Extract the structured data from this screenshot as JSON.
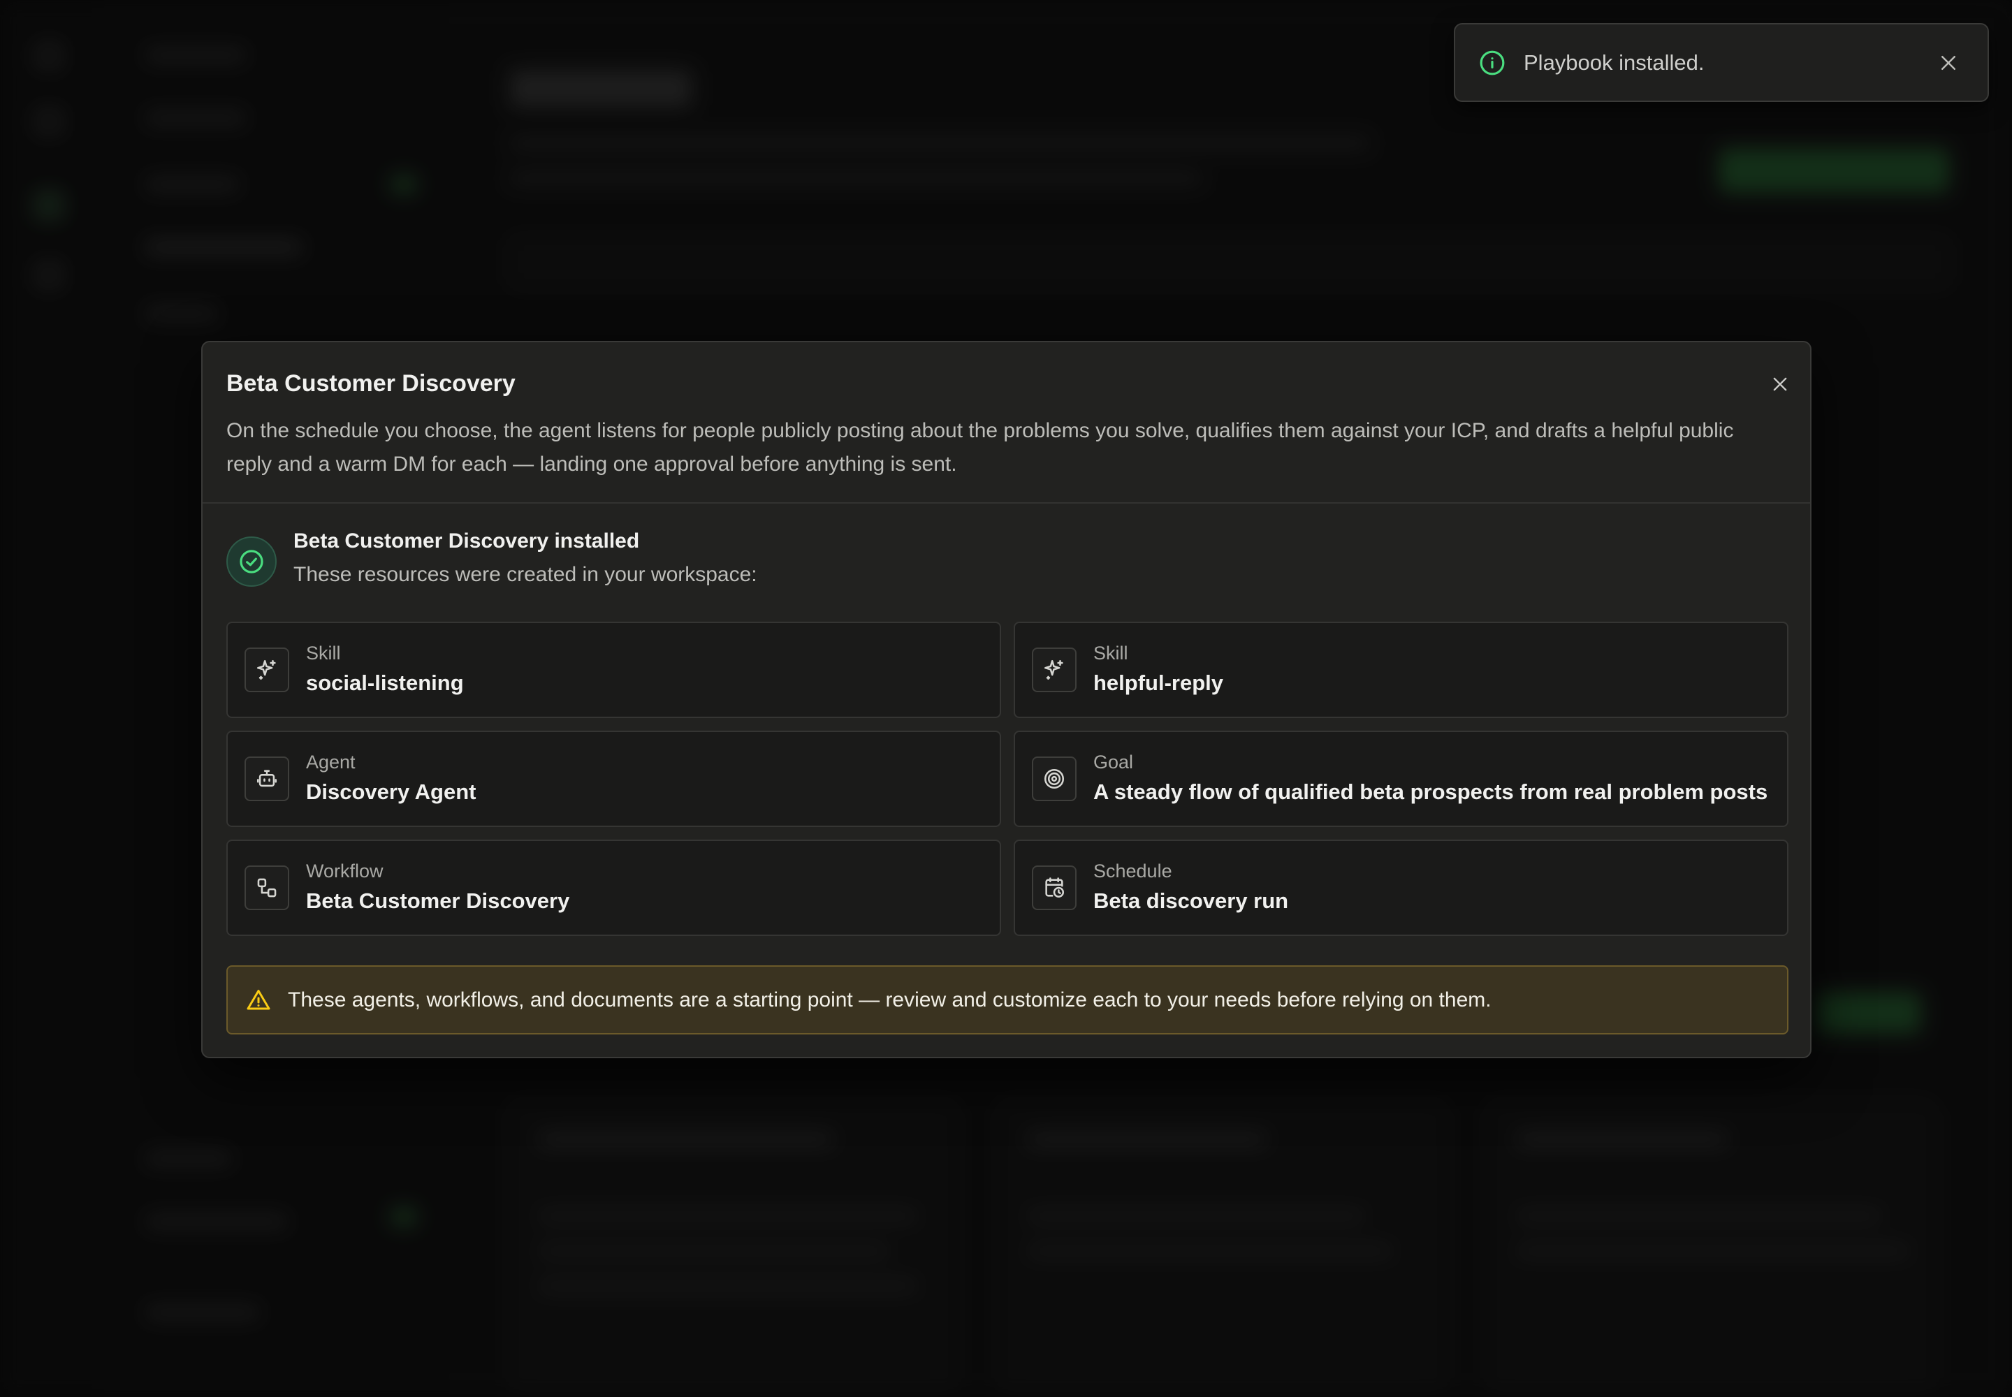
{
  "toast": {
    "message": "Playbook installed.",
    "icon": "info-icon",
    "close_icon": "close-icon"
  },
  "dialog": {
    "title": "Beta Customer Discovery",
    "description": "On the schedule you choose, the agent listens for people publicly posting about the problems you solve, qualifies them against your ICP, and drafts a helpful public reply and a warm DM for each — landing one approval before anything is sent.",
    "installed_title": "Beta Customer Discovery installed",
    "installed_subtitle": "These resources were created in your workspace:",
    "resources": [
      {
        "kind": "Skill",
        "name": "social-listening",
        "icon": "sparkles-icon"
      },
      {
        "kind": "Skill",
        "name": "helpful-reply",
        "icon": "sparkles-icon"
      },
      {
        "kind": "Agent",
        "name": "Discovery Agent",
        "icon": "bot-icon"
      },
      {
        "kind": "Goal",
        "name": "A steady flow of qualified beta prospects from real problem posts",
        "icon": "target-icon"
      },
      {
        "kind": "Workflow",
        "name": "Beta Customer Discovery",
        "icon": "workflow-icon"
      },
      {
        "kind": "Schedule",
        "name": "Beta discovery run",
        "icon": "calendar-clock-icon"
      }
    ],
    "warning": "These agents, workflows, and documents are a starting point — review and customize each to your needs before relying on them."
  },
  "colors": {
    "accent_green": "#4ade80",
    "warning_bg": "#3a3320",
    "warning_icon": "#facc15",
    "dialog_bg": "#222220"
  }
}
